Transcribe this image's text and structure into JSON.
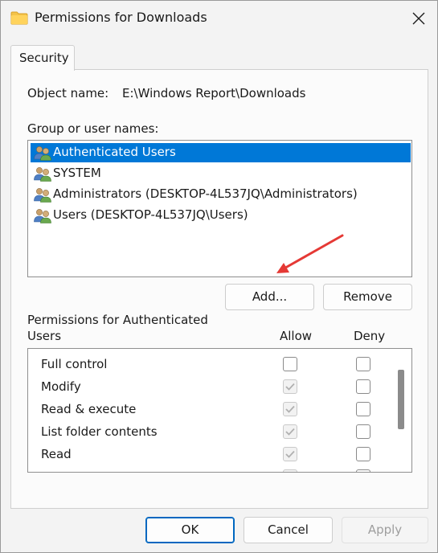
{
  "window": {
    "title": "Permissions for Downloads",
    "close_icon": "close-icon"
  },
  "tabs": [
    {
      "label": "Security"
    }
  ],
  "object": {
    "label": "Object name:",
    "value": "E:\\Windows Report\\Downloads"
  },
  "groups": {
    "label": "Group or user names:",
    "items": [
      {
        "name": "Authenticated Users",
        "selected": true,
        "icon": "user-group-icon"
      },
      {
        "name": "SYSTEM",
        "selected": false,
        "icon": "user-group-icon"
      },
      {
        "name": "Administrators (DESKTOP-4L537JQ\\Administrators)",
        "selected": false,
        "icon": "user-group-icon"
      },
      {
        "name": "Users (DESKTOP-4L537JQ\\Users)",
        "selected": false,
        "icon": "user-group-icon"
      }
    ]
  },
  "buttons": {
    "add": "Add...",
    "remove": "Remove",
    "ok": "OK",
    "cancel": "Cancel",
    "apply": "Apply"
  },
  "permissions": {
    "label_line1": "Permissions for Authenticated",
    "label_line2": "Users",
    "allow_header": "Allow",
    "deny_header": "Deny",
    "rows": [
      {
        "name": "Full control",
        "allow": false,
        "deny": false
      },
      {
        "name": "Modify",
        "allow": true,
        "deny": false
      },
      {
        "name": "Read & execute",
        "allow": true,
        "deny": false
      },
      {
        "name": "List folder contents",
        "allow": true,
        "deny": false
      },
      {
        "name": "Read",
        "allow": true,
        "deny": false
      }
    ]
  },
  "colors": {
    "selection": "#0078d7",
    "annotation_arrow": "#e53935",
    "primary_border": "#0067c0"
  }
}
